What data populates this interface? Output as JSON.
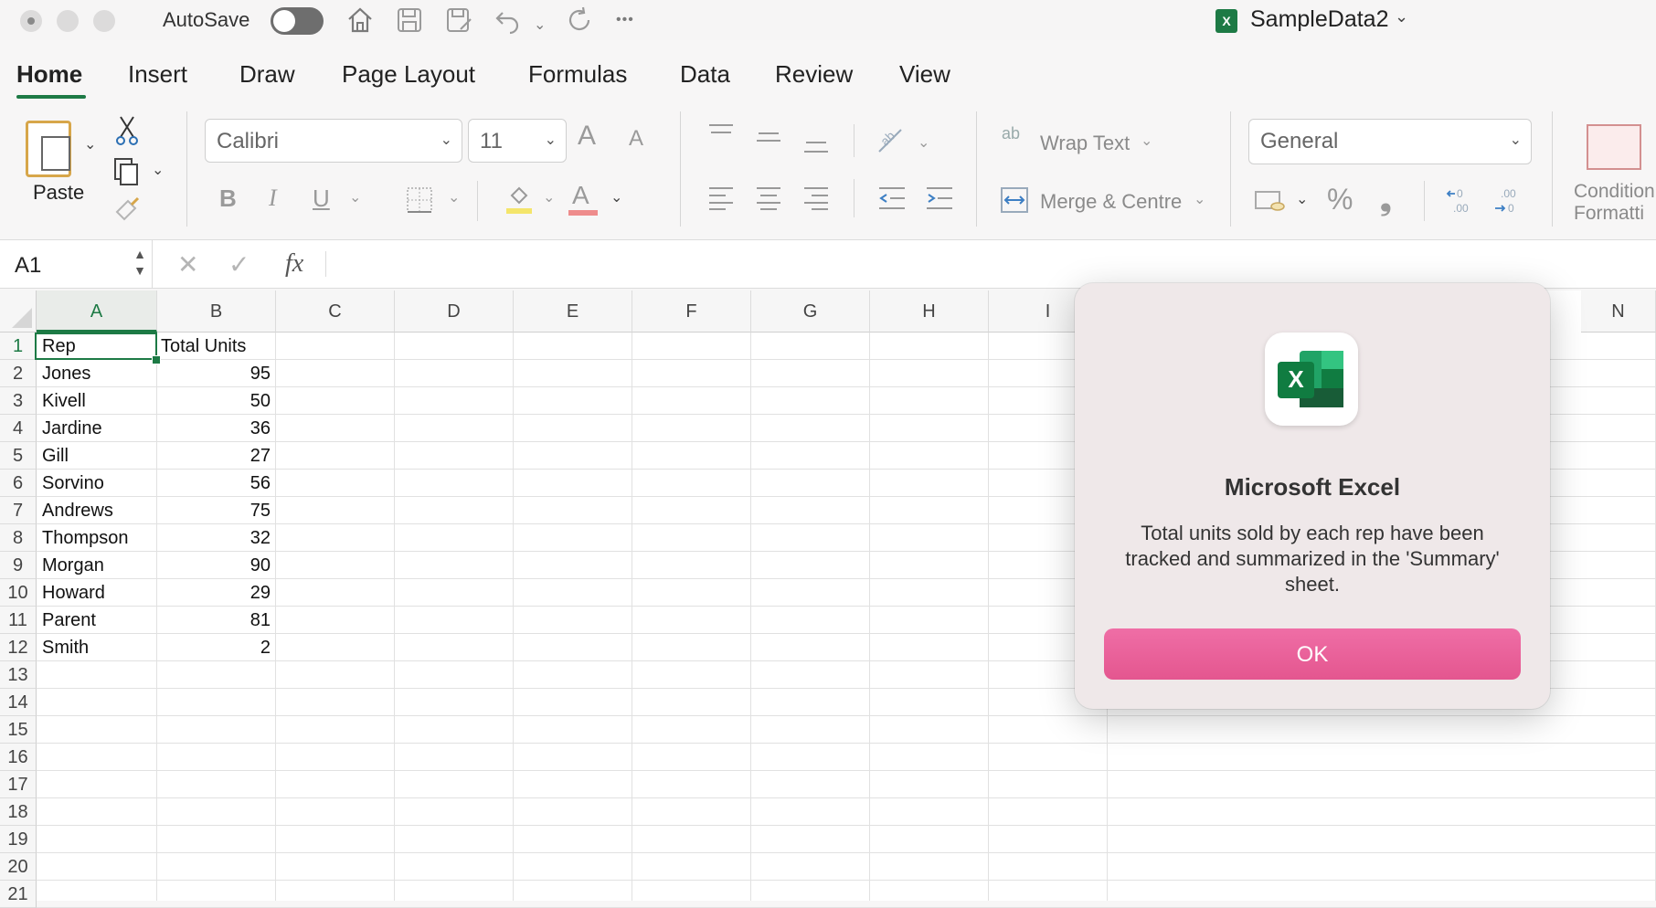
{
  "titlebar": {
    "autosave_label": "AutoSave",
    "autosave_on": false,
    "document_title": "SampleData2",
    "doc_icon_letter": "X",
    "more_label": "•••"
  },
  "tabs": [
    {
      "label": "Home",
      "active": true
    },
    {
      "label": "Insert"
    },
    {
      "label": "Draw"
    },
    {
      "label": "Page Layout"
    },
    {
      "label": "Formulas"
    },
    {
      "label": "Data"
    },
    {
      "label": "Review"
    },
    {
      "label": "View"
    }
  ],
  "ribbon": {
    "paste_label": "Paste",
    "font_name": "Calibri",
    "font_size": "11",
    "wrap_text_label": "Wrap Text",
    "merge_label": "Merge & Centre",
    "number_format": "General",
    "conditional_label_1": "Condition",
    "conditional_label_2": "Formatti",
    "bold": "B",
    "italic": "I",
    "underline": "U",
    "grow_font": "A",
    "shrink_font": "A",
    "font_color_letter": "A",
    "percent": "%",
    "comma": "❟",
    "wrap_glyph": "ab",
    "inc_decimal": "←0\n.00",
    "dec_decimal": ".00\n→0",
    "accent_color": "#1d7a45"
  },
  "formula_bar": {
    "name_box": "A1",
    "fx": "fx",
    "formula": ""
  },
  "sheet": {
    "columns": [
      "A",
      "B",
      "C",
      "D",
      "E",
      "F",
      "G",
      "H",
      "I",
      "N"
    ],
    "selected_column": "A",
    "rows": [
      "1",
      "2",
      "3",
      "4",
      "5",
      "6",
      "7",
      "8",
      "9",
      "10",
      "11",
      "12",
      "13",
      "14",
      "15",
      "16",
      "17",
      "18",
      "19",
      "20",
      "21"
    ],
    "selected_row": "1",
    "cells": [
      {
        "a": "Rep",
        "b": "Total Units"
      },
      {
        "a": "Jones",
        "b": "95"
      },
      {
        "a": "Kivell",
        "b": "50"
      },
      {
        "a": "Jardine",
        "b": "36"
      },
      {
        "a": "Gill",
        "b": "27"
      },
      {
        "a": "Sorvino",
        "b": "56"
      },
      {
        "a": "Andrews",
        "b": "75"
      },
      {
        "a": "Thompson",
        "b": "32"
      },
      {
        "a": "Morgan",
        "b": "90"
      },
      {
        "a": "Howard",
        "b": "29"
      },
      {
        "a": "Parent",
        "b": "81"
      },
      {
        "a": "Smith",
        "b": "2"
      }
    ]
  },
  "dialog": {
    "title": "Microsoft Excel",
    "message": "Total units sold by each rep have been tracked and summarized in the 'Summary' sheet.",
    "ok_label": "OK",
    "ok_color": "#e85b95",
    "icon_letter": "X"
  }
}
